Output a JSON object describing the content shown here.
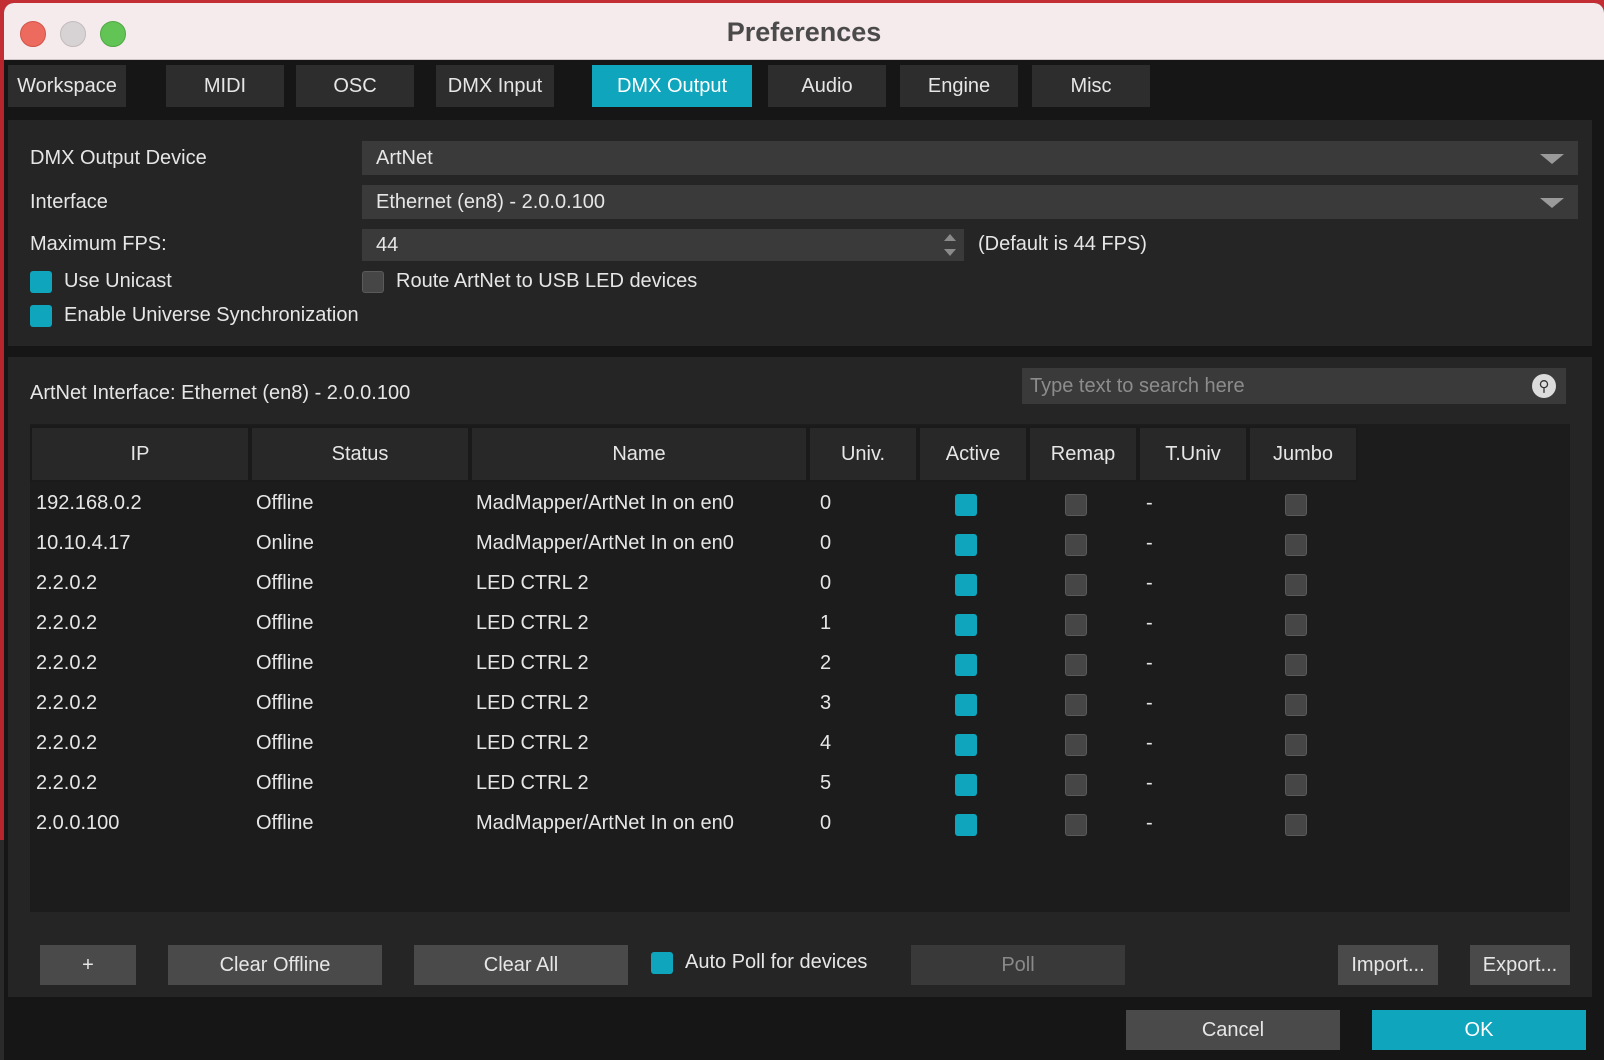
{
  "window": {
    "title": "Preferences"
  },
  "tabs": [
    {
      "label": "Workspace"
    },
    {
      "label": "MIDI"
    },
    {
      "label": "OSC"
    },
    {
      "label": "DMX Input"
    },
    {
      "label": "DMX Output"
    },
    {
      "label": "Audio"
    },
    {
      "label": "Engine"
    },
    {
      "label": "Misc"
    }
  ],
  "active_tab": "DMX Output",
  "settings": {
    "output_device_label": "DMX Output Device",
    "output_device_value": "ArtNet",
    "interface_label": "Interface",
    "interface_value": "Ethernet (en8) - 2.0.0.100",
    "max_fps_label": "Maximum FPS:",
    "max_fps_value": "44",
    "max_fps_hint": "(Default is 44 FPS)",
    "use_unicast_label": "Use Unicast",
    "use_unicast_checked": true,
    "route_usb_label": "Route ArtNet to USB LED devices",
    "route_usb_checked": false,
    "sync_label": "Enable Universe Synchronization",
    "sync_checked": true
  },
  "artnet": {
    "interface_title": "ArtNet Interface: Ethernet (en8) - 2.0.0.100",
    "search_placeholder": "Type text to search here"
  },
  "table": {
    "columns": [
      "IP",
      "Status",
      "Name",
      "Univ.",
      "Active",
      "Remap",
      "T.Univ",
      "Jumbo"
    ],
    "rows": [
      {
        "ip": "192.168.0.2",
        "status": "Offline",
        "name": "MadMapper/ArtNet In on en0",
        "univ": "0",
        "active": true,
        "remap": false,
        "tuniv": "-",
        "jumbo": false
      },
      {
        "ip": "10.10.4.17",
        "status": "Online",
        "name": "MadMapper/ArtNet In on en0",
        "univ": "0",
        "active": true,
        "remap": false,
        "tuniv": "-",
        "jumbo": false
      },
      {
        "ip": "2.2.0.2",
        "status": "Offline",
        "name": "LED CTRL 2",
        "univ": "0",
        "active": true,
        "remap": false,
        "tuniv": "-",
        "jumbo": false
      },
      {
        "ip": "2.2.0.2",
        "status": "Offline",
        "name": "LED CTRL 2",
        "univ": "1",
        "active": true,
        "remap": false,
        "tuniv": "-",
        "jumbo": false
      },
      {
        "ip": "2.2.0.2",
        "status": "Offline",
        "name": "LED CTRL 2",
        "univ": "2",
        "active": true,
        "remap": false,
        "tuniv": "-",
        "jumbo": false
      },
      {
        "ip": "2.2.0.2",
        "status": "Offline",
        "name": "LED CTRL 2",
        "univ": "3",
        "active": true,
        "remap": false,
        "tuniv": "-",
        "jumbo": false
      },
      {
        "ip": "2.2.0.2",
        "status": "Offline",
        "name": "LED CTRL 2",
        "univ": "4",
        "active": true,
        "remap": false,
        "tuniv": "-",
        "jumbo": false
      },
      {
        "ip": "2.2.0.2",
        "status": "Offline",
        "name": "LED CTRL 2",
        "univ": "5",
        "active": true,
        "remap": false,
        "tuniv": "-",
        "jumbo": false
      },
      {
        "ip": "2.0.0.100",
        "status": "Offline",
        "name": "MadMapper/ArtNet In on en0",
        "univ": "0",
        "active": true,
        "remap": false,
        "tuniv": "-",
        "jumbo": false
      }
    ]
  },
  "actions": {
    "add_label": "+",
    "clear_offline_label": "Clear Offline",
    "clear_all_label": "Clear All",
    "auto_poll_label": "Auto Poll for devices",
    "auto_poll_checked": true,
    "poll_label": "Poll",
    "import_label": "Import...",
    "export_label": "Export..."
  },
  "footer": {
    "cancel_label": "Cancel",
    "ok_label": "OK"
  },
  "colors": {
    "accent": "#0ea5bd",
    "panel": "#252525",
    "window_bg": "#161616"
  }
}
